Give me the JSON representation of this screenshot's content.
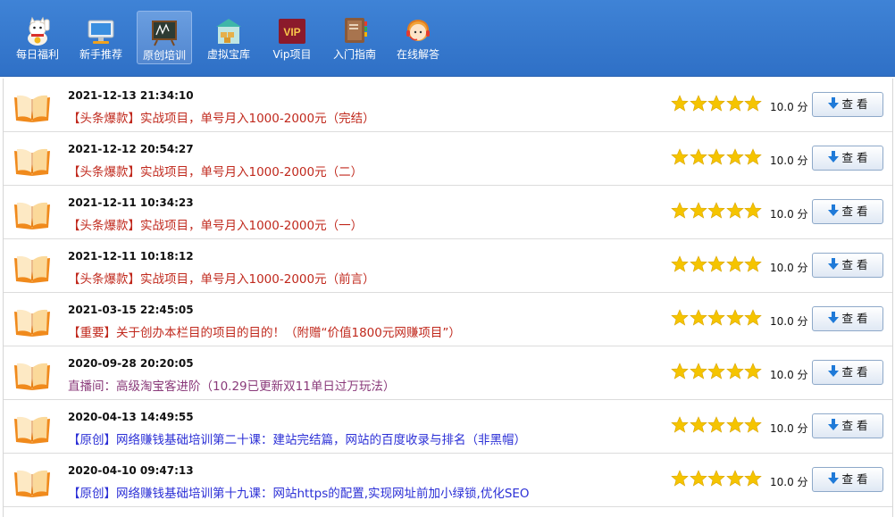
{
  "toolbar": {
    "items": [
      {
        "label": "每日福利",
        "icon": "lucky-cat-icon"
      },
      {
        "label": "新手推荐",
        "icon": "computer-icon"
      },
      {
        "label": "原创培训",
        "icon": "blackboard-icon",
        "active": true
      },
      {
        "label": "虚拟宝库",
        "icon": "warehouse-icon"
      },
      {
        "label": "Vip项目",
        "icon": "vip-badge-icon"
      },
      {
        "label": "入门指南",
        "icon": "book-stack-icon"
      },
      {
        "label": "在线解答",
        "icon": "support-agent-icon"
      }
    ],
    "vip_badge_text": "VIP"
  },
  "list": {
    "star_color": "#f5c400",
    "rows": [
      {
        "date": "2021-12-13 21:34:10",
        "title": "【头条爆款】实战项目，单号月入1000-2000元（完结）",
        "title_color": "red",
        "score": "10.0 分",
        "button": "查 看",
        "rating": 5
      },
      {
        "date": "2021-12-12 20:54:27",
        "title": "【头条爆款】实战项目，单号月入1000-2000元（二）",
        "title_color": "red",
        "score": "10.0 分",
        "button": "查 看",
        "rating": 5
      },
      {
        "date": "2021-12-11 10:34:23",
        "title": "【头条爆款】实战项目，单号月入1000-2000元（一）",
        "title_color": "red",
        "score": "10.0 分",
        "button": "查 看",
        "rating": 5
      },
      {
        "date": "2021-12-11 10:18:12",
        "title": "【头条爆款】实战项目，单号月入1000-2000元（前言）",
        "title_color": "red",
        "score": "10.0 分",
        "button": "查 看",
        "rating": 5
      },
      {
        "date": "2021-03-15 22:45:05",
        "title": "【重要】关于创办本栏目的项目的目的！（附赠“价值1800元网赚项目”）",
        "title_color": "red",
        "score": "10.0 分",
        "button": "查 看",
        "rating": 5
      },
      {
        "date": "2020-09-28 20:20:05",
        "title": "直播间：高级淘宝客进阶（10.29已更新双11单日过万玩法）",
        "title_color": "purple",
        "score": "10.0 分",
        "button": "查 看",
        "rating": 5
      },
      {
        "date": "2020-04-13 14:49:55",
        "title": "【原创】网络赚钱基础培训第二十课：建站完结篇，网站的百度收录与排名（非黑帽）",
        "title_color": "blue",
        "score": "10.0 分",
        "button": "查 看",
        "rating": 5
      },
      {
        "date": "2020-04-10 09:47:13",
        "title": "【原创】网络赚钱基础培训第十九课：网站https的配置,实现网址前加小绿锁,优化SEO",
        "title_color": "blue",
        "score": "10.0 分",
        "button": "查 看",
        "rating": 5
      }
    ]
  }
}
